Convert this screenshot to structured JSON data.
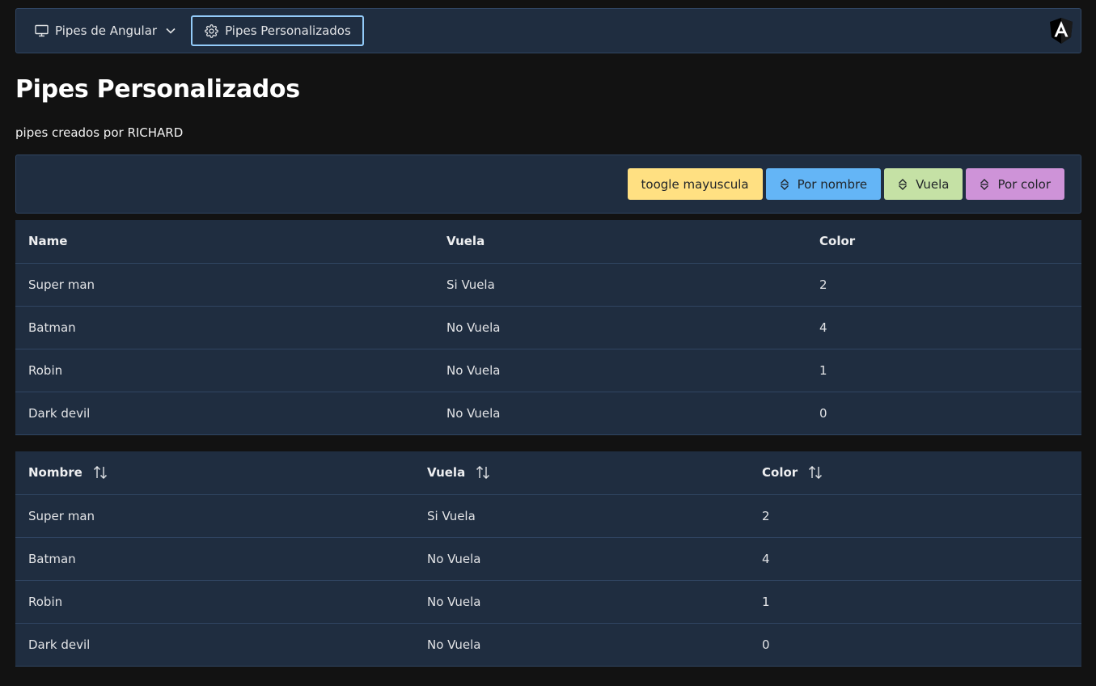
{
  "menubar": {
    "items": [
      {
        "label": "Pipes de Angular",
        "icon": "desktop-icon",
        "has_dropdown": true
      },
      {
        "label": "Pipes Personalizados",
        "icon": "gear-icon",
        "active": true
      }
    ],
    "logo": "angular-logo"
  },
  "page": {
    "title": "Pipes Personalizados",
    "subtitle": "pipes creados por RICHARD"
  },
  "toolbar": {
    "buttons": [
      {
        "label": "toogle mayuscula",
        "color": "#ffe082"
      },
      {
        "label": "Por nombre",
        "icon": "sort-icon",
        "color": "#64b5f6"
      },
      {
        "label": "Vuela",
        "icon": "sort-icon",
        "color": "#c5e1a5"
      },
      {
        "label": "Por color",
        "icon": "sort-icon",
        "color": "#ce93d8"
      }
    ]
  },
  "table1": {
    "headers": [
      "Name",
      "Vuela",
      "Color"
    ],
    "rows": [
      [
        "Super man",
        "Si Vuela",
        "2"
      ],
      [
        "Batman",
        "No Vuela",
        "4"
      ],
      [
        "Robin",
        "No Vuela",
        "1"
      ],
      [
        "Dark devil",
        "No Vuela",
        "0"
      ]
    ]
  },
  "table2": {
    "headers": [
      "Nombre",
      "Vuela",
      "Color"
    ],
    "rows": [
      [
        "Super man",
        "Si Vuela",
        "2"
      ],
      [
        "Batman",
        "No Vuela",
        "4"
      ],
      [
        "Robin",
        "No Vuela",
        "1"
      ],
      [
        "Dark devil",
        "No Vuela",
        "0"
      ]
    ]
  },
  "colors": {
    "background": "#121212",
    "surface": "#1f2d40",
    "border": "#304562",
    "active_outline": "#93cbf9"
  }
}
